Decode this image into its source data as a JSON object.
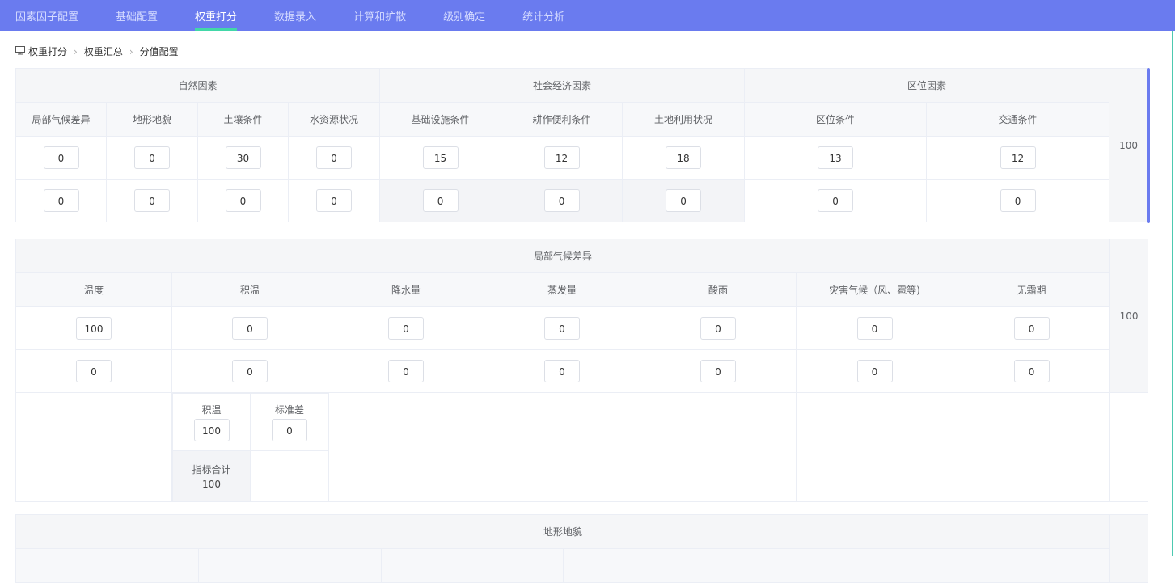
{
  "nav": {
    "tabs": [
      {
        "label": "因素因子配置",
        "active": false
      },
      {
        "label": "基础配置",
        "active": false
      },
      {
        "label": "权重打分",
        "active": true
      },
      {
        "label": "数据录入",
        "active": false
      },
      {
        "label": "计算和扩散",
        "active": false
      },
      {
        "label": "级别确定",
        "active": false
      },
      {
        "label": "统计分析",
        "active": false
      }
    ]
  },
  "breadcrumb": {
    "items": [
      "权重打分",
      "权重汇总",
      "分值配置"
    ]
  },
  "summary": {
    "groups": [
      "自然因素",
      "社会经济因素",
      "区位因素"
    ],
    "factors": [
      "局部气候差异",
      "地形地貌",
      "土壤条件",
      "水资源状况",
      "基础设施条件",
      "耕作便利条件",
      "土地利用状况",
      "区位条件",
      "交通条件"
    ],
    "row1": [
      "0",
      "0",
      "30",
      "0",
      "15",
      "12",
      "18",
      "13",
      "12"
    ],
    "row2": [
      "0",
      "0",
      "0",
      "0",
      "0",
      "0",
      "0",
      "0",
      "0"
    ],
    "total": "100"
  },
  "climate": {
    "title": "局部气候差异",
    "columns": [
      "温度",
      "积温",
      "降水量",
      "蒸发量",
      "酸雨",
      "灾害气候（风、雹等)",
      "无霜期"
    ],
    "row1": [
      "100",
      "0",
      "0",
      "0",
      "0",
      "0",
      "0"
    ],
    "row2": [
      "0",
      "0",
      "0",
      "0",
      "0",
      "0",
      "0"
    ],
    "total": "100",
    "sub": {
      "accum_label": "积温",
      "accum_value": "100",
      "std_label": "标准差",
      "std_value": "0",
      "sum_label": "指标合计",
      "sum_value": "100"
    }
  },
  "terrain": {
    "title": "地形地貌"
  },
  "colors": {
    "nav_bg": "#6a7bef",
    "active_underline": "#42d7a8",
    "accent": "#6a7bef"
  }
}
